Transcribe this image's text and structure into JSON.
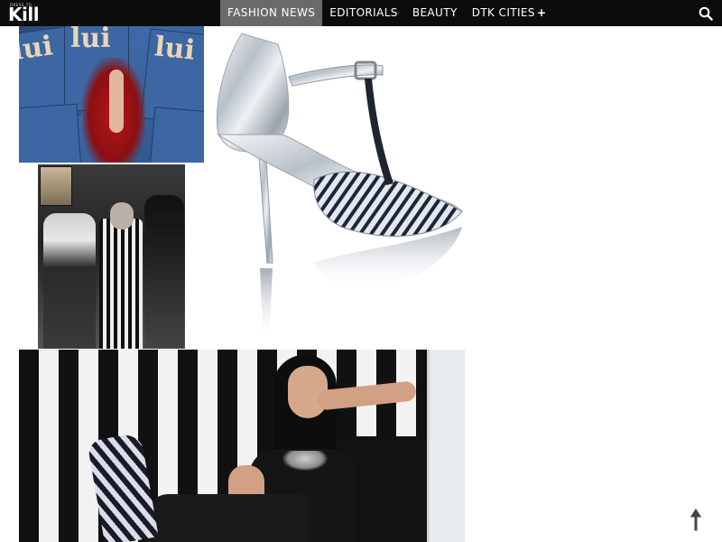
{
  "header": {
    "logo": {
      "small_text": "DRESS TO",
      "main_text": "Kill"
    },
    "nav": [
      {
        "label": "FASHION NEWS",
        "active": true
      },
      {
        "label": "EDITORIALS",
        "active": false
      },
      {
        "label": "BEAUTY",
        "active": false
      },
      {
        "label": "DTK CITIES",
        "active": false,
        "has_submenu": true
      }
    ],
    "nav_submenu_indicator": "+",
    "search_icon": "search-icon"
  },
  "images": [
    {
      "name": "magazine-cover-collage",
      "cover_text": "lui"
    },
    {
      "name": "band-editorial-photo"
    },
    {
      "name": "silver-t-strap-heel-photo"
    },
    {
      "name": "striped-room-portrait-photo"
    }
  ],
  "back_to_top_icon": "arrow-up-icon",
  "colors": {
    "topbar": "#0c0c0c",
    "nav_active": "#6a6a6a",
    "nav_text": "#ffffff"
  }
}
